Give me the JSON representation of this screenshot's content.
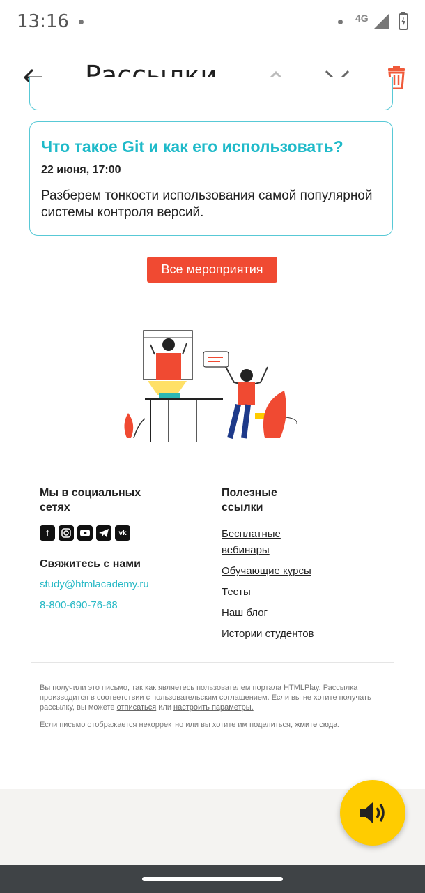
{
  "status_bar": {
    "time": "13:16",
    "network": "4G"
  },
  "app_bar": {
    "title": "Рассылки"
  },
  "event_card": {
    "title": "Что такое Git и как его использовать?",
    "date": "22 июня, 17:00",
    "description": "Разберем тонкости использования самой популярной системы контроля версий."
  },
  "all_events_button": "Все мероприятия",
  "footer": {
    "social_heading": "Мы в социальных сетях",
    "social_icons": [
      "facebook-icon",
      "instagram-icon",
      "youtube-icon",
      "telegram-icon",
      "vk-icon"
    ],
    "contact_heading": "Свяжитесь с нами",
    "email": "study@htmlacademy.ru",
    "phone": "8-800-690-76-68",
    "links_heading": "Полезные ссылки",
    "links": [
      "Бесплатные вебинары",
      "Обучающие курсы",
      "Тесты",
      "Наш блог",
      "Истории студентов"
    ],
    "disclaimer_prefix": "Вы получили это письмо, так как являетесь пользователем портала HTMLPlay. Рассылка производится в соответствии с пользовательским соглашением. Если вы не хотите получать рассылку, вы можете ",
    "unsubscribe_link": "отписаться",
    "disclaimer_or": " или ",
    "settings_link": "настроить параметры.",
    "display_note": "Если письмо отображается некорректно или вы хотите им поделиться, ",
    "click_here_link": "жмите сюда."
  },
  "colors": {
    "accent_teal": "#1fbac9",
    "button_red": "#f04a32",
    "fab_yellow": "#ffcc00",
    "trash_red": "#f05a3a"
  }
}
